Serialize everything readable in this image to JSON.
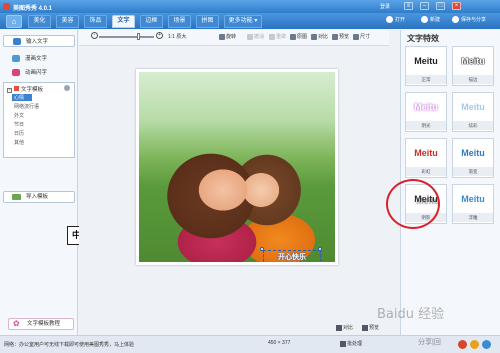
{
  "titlebar": {
    "app_title": "美图秀秀 4.0.1",
    "login": "登录",
    "btn_open": "打开",
    "btn_new": "新建",
    "btn_save": "保存与分享"
  },
  "menu": {
    "tabs": [
      "美化",
      "美容",
      "饰品",
      "文字",
      "边框",
      "场景",
      "拼图"
    ],
    "more": "更多功能 ▾",
    "active_index": 3
  },
  "left": {
    "input_text": "输入文字",
    "dynamic_text": "漫画文字",
    "animated_text": "动画闪字",
    "tree_title": "文字模板",
    "tree_items": [
      "心情",
      "网络流行语",
      "外文",
      "节日",
      "日历",
      "其他"
    ],
    "import_template": "导入模板",
    "template_tip": "文字模板教程",
    "zh_label": "中"
  },
  "toolbar": {
    "zoom_label": "1:1 原大",
    "rotate": "旋转",
    "undo": "撤消",
    "redo": "重做",
    "original": "原图",
    "compare": "对比",
    "preview": "预览",
    "size": "尺寸"
  },
  "canvas": {
    "photo_text": "开心快乐"
  },
  "right": {
    "title": "文字特效",
    "effects": [
      {
        "preview": "Meitu",
        "label": "正常",
        "color": "#222222"
      },
      {
        "preview": "Meitu",
        "label": "描边",
        "color": "#111111"
      },
      {
        "preview": "Meitu",
        "label": "阴光",
        "color": "#d9a7e6"
      },
      {
        "preview": "Meitu",
        "label": "炫彩",
        "color": "#9bc0e6"
      },
      {
        "preview": "Meitu",
        "label": "彩虹",
        "color": "#c7302a"
      },
      {
        "preview": "Meitu",
        "label": "渐变",
        "color": "#2c7ac9"
      },
      {
        "preview": "Meitu",
        "label": "阴影",
        "color": "#333333"
      },
      {
        "preview": "Meitu",
        "label": "浮雕",
        "color": "#3a8bd6"
      }
    ]
  },
  "statusbar": {
    "message": "网络：办公室用户可无线下载即可使用美图秀秀，马上体验",
    "image_size": "450 × 377",
    "compare": "对比",
    "preview": "预览",
    "settings": "批处理"
  },
  "watermark": "Baidu 经验",
  "watermark_sub": "分享|回"
}
